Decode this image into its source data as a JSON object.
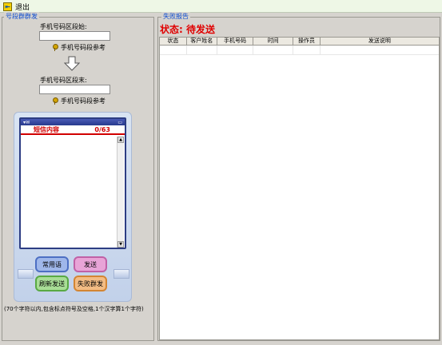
{
  "toolbar": {
    "exit_label": "退出",
    "exit_icon": "exit-icon"
  },
  "left_panel": {
    "title": "号段群群发",
    "start_label": "手机号码区段始:",
    "start_value": "",
    "ref1_label": "手机号码段参考",
    "end_label": "手机号码区段末:",
    "end_value": "",
    "ref2_label": "手机号码段参考"
  },
  "phone": {
    "header_title": "短信内容",
    "counter": "0/63",
    "textarea_value": "",
    "buttons": {
      "common_phrases": "常用语",
      "send": "发送",
      "refresh_send": "刷新发送",
      "fail_mass_send": "失败群发"
    },
    "colors": {
      "common_phrases": "#9fb7ea",
      "send": "#e8a4d7",
      "refresh_send": "#a8dd96",
      "fail_mass_send": "#f3bc84"
    }
  },
  "note": "(70个字符以内,包含标点符号及空格,1个汉字算1个字符)",
  "right_panel": {
    "title": "失败报告",
    "status_text": "状态: 待发送",
    "columns": [
      "状态",
      "客户姓名",
      "手机号码",
      "时间",
      "操作员",
      "发送说明"
    ]
  }
}
